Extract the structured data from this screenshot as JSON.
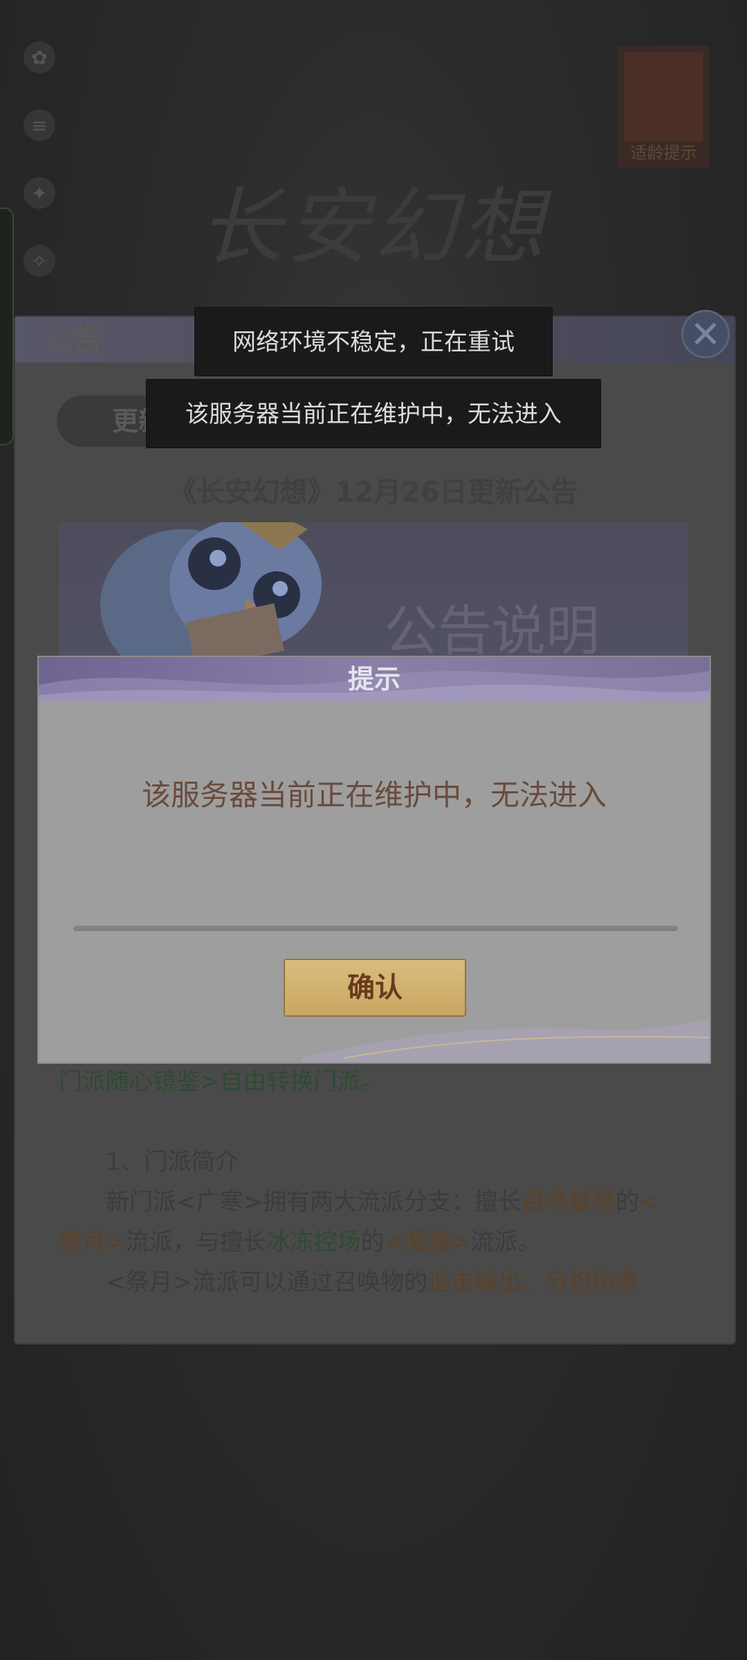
{
  "background": {
    "badge_label": "适龄提示",
    "game_logo": "长安幻想",
    "bottom_faint_text": "",
    "bottom_small_text": ""
  },
  "notice": {
    "title": "公告",
    "tab_label": "更新公告",
    "subtitle": "《长安幻想》12月26日更新公告",
    "banner_text": "公告说明",
    "body": {
      "line1": "门派随心镜鉴>自由转换门派。",
      "line2": "1、门派简介",
      "line3_prefix": "新门派<广寒>拥有两大流派分支：擅长",
      "line3_hl": "召唤献祭",
      "line3_mid": "的",
      "line3_hl2": "<",
      "line4_hl": "祭月>",
      "line4_mid": "流派，与擅长",
      "line4_hl2": "冰冻控场",
      "line4_mid2": "的",
      "line4_hl3": "<凝霜>",
      "line4_suffix": "流派。",
      "line5_prefix": "<祭月>流派可以通过召唤物的",
      "line5_hl": "追击输出、分担伤害"
    }
  },
  "toasts": {
    "network": "网络环境不稳定，正在重试",
    "maintenance": "该服务器当前正在维护中，无法进入"
  },
  "dialog": {
    "title": "提示",
    "message": "该服务器当前正在维护中，无法进入",
    "confirm_label": "确认"
  },
  "colors": {
    "dialog_header": "#8a7fa9",
    "confirm_button": "#d9bd7e",
    "message_text": "#6a4a3c"
  }
}
